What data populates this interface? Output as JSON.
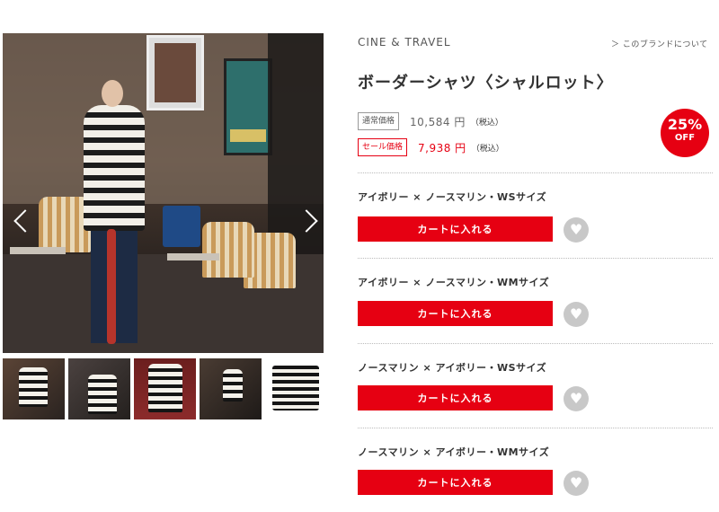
{
  "gallery": {
    "prev_arrow_icon": "chevron-left-icon",
    "next_arrow_icon": "chevron-right-icon",
    "thumbnails": [
      {
        "icon": "thumbnail-image"
      },
      {
        "icon": "thumbnail-image"
      },
      {
        "icon": "thumbnail-image"
      },
      {
        "icon": "thumbnail-image"
      },
      {
        "icon": "thumbnail-image"
      }
    ]
  },
  "product": {
    "brand": "CINE & TRAVEL",
    "brand_link": "＞ このブランドについて",
    "title": "ボーダーシャツ〈シャルロット〉",
    "regular_label": "通常価格",
    "regular_price": "10,584 円",
    "regular_tax": "（税込）",
    "sale_label": "セール価格",
    "sale_price": "7,938 円",
    "sale_tax": "（税込）",
    "discount_percent": "25%",
    "discount_off": "OFF"
  },
  "variants": [
    {
      "name": "アイボリー × ノースマリン・WSサイズ",
      "cart_label": "カートに入れる",
      "fav_icon": "heart-icon"
    },
    {
      "name": "アイボリー × ノースマリン・WMサイズ",
      "cart_label": "カートに入れる",
      "fav_icon": "heart-icon"
    },
    {
      "name": "ノースマリン × アイボリー・WSサイズ",
      "cart_label": "カートに入れる",
      "fav_icon": "heart-icon"
    },
    {
      "name": "ノースマリン × アイボリー・WMサイズ",
      "cart_label": "カートに入れる",
      "fav_icon": "heart-icon"
    }
  ],
  "colors": {
    "accent": "#e60012",
    "fav_bg": "#c8c8c8"
  }
}
